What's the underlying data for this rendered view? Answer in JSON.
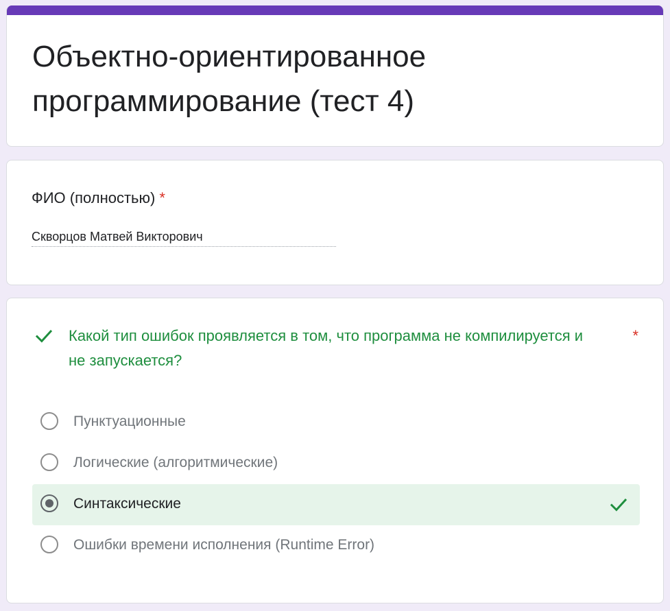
{
  "colors": {
    "accent": "#673ab7",
    "page_background": "#f0ebf8",
    "correct_green": "#1e8e3e",
    "correct_background": "#e6f4ea",
    "required_red": "#d93025"
  },
  "form": {
    "title": "Объектно-ориентированное программирование (тест 4)"
  },
  "name_question": {
    "label": "ФИО (полностью)",
    "required_mark": "*",
    "answer": "Скворцов Матвей Викторович"
  },
  "question": {
    "status_icon": "check-icon",
    "text": "Какой тип ошибок проявляется в том, что программа не компилируется и не запускается?",
    "required_mark": "*",
    "options": [
      {
        "label": "Пунктуационные",
        "selected": false
      },
      {
        "label": "Логические (алгоритмические)",
        "selected": false
      },
      {
        "label": "Синтаксические",
        "selected": true,
        "correct": true
      },
      {
        "label": "Ошибки времени исполнения (Runtime Error)",
        "selected": false
      }
    ]
  }
}
